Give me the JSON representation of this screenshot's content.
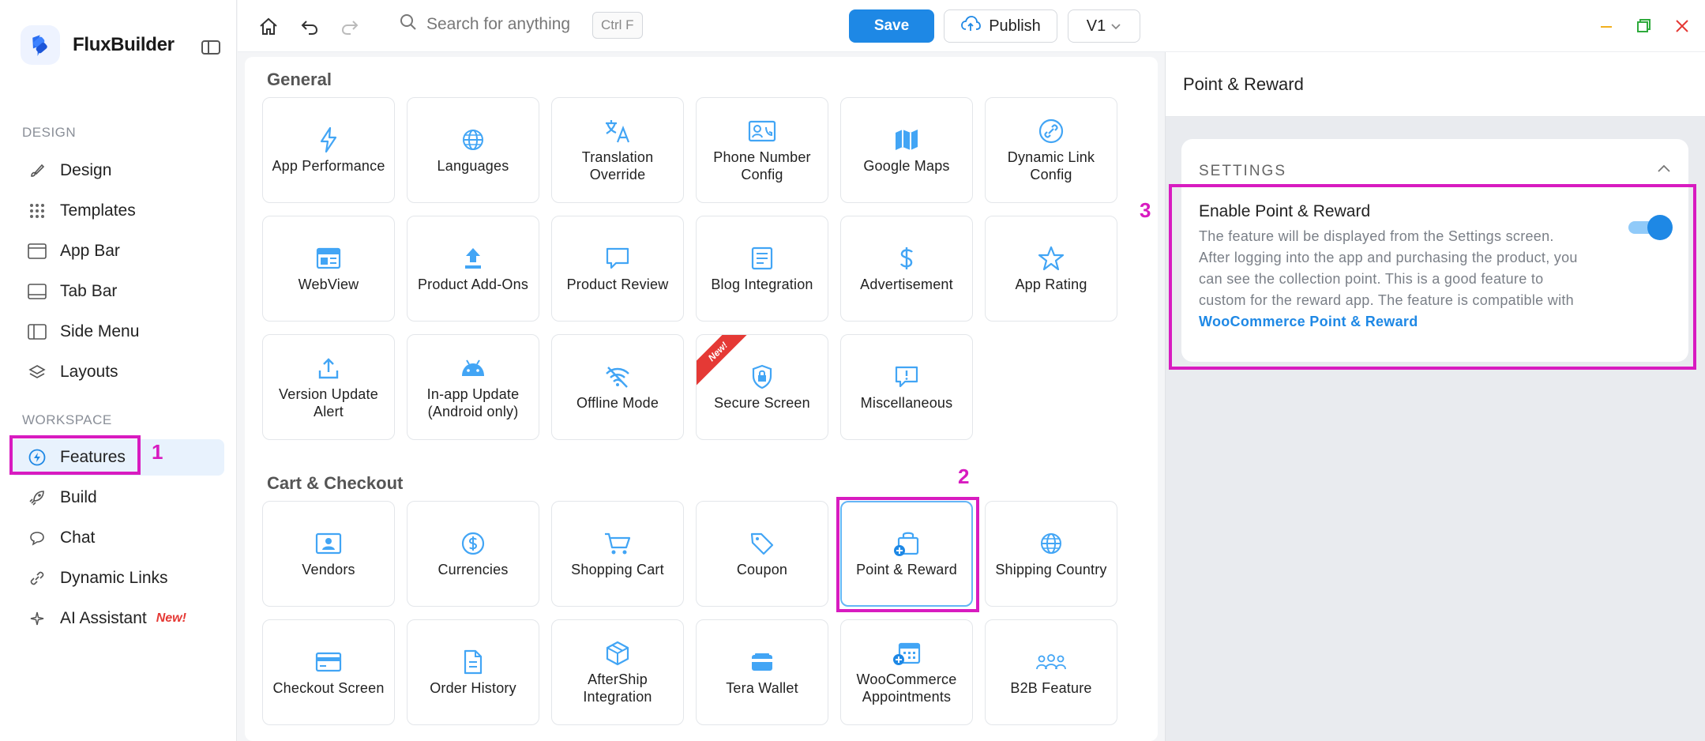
{
  "app": {
    "name": "FluxBuilder"
  },
  "sidebar": {
    "design_label": "DESIGN",
    "workspace_label": "WORKSPACE",
    "design_items": [
      {
        "label": "Design",
        "icon": "brush-icon"
      },
      {
        "label": "Templates",
        "icon": "grid-icon"
      },
      {
        "label": "App Bar",
        "icon": "app-bar-icon"
      },
      {
        "label": "Tab Bar",
        "icon": "tab-bar-icon"
      },
      {
        "label": "Side Menu",
        "icon": "side-menu-icon"
      },
      {
        "label": "Layouts",
        "icon": "layers-icon"
      }
    ],
    "workspace_items": [
      {
        "label": "Features",
        "icon": "lightning-icon",
        "active": true
      },
      {
        "label": "Build",
        "icon": "rocket-icon"
      },
      {
        "label": "Chat",
        "icon": "chat-icon"
      },
      {
        "label": "Dynamic Links",
        "icon": "link-icon"
      },
      {
        "label": "AI Assistant",
        "icon": "sparkle-icon",
        "badge": "New!"
      }
    ]
  },
  "topbar": {
    "search_placeholder": "Search for anything",
    "shortcut": "Ctrl F",
    "save_label": "Save",
    "publish_label": "Publish",
    "version_label": "V1"
  },
  "features": {
    "general_title": "General",
    "general": [
      {
        "label": "App Performance",
        "icon": "lightning-icon"
      },
      {
        "label": "Languages",
        "icon": "globe-icon"
      },
      {
        "label": "Translation Override",
        "icon": "translate-icon"
      },
      {
        "label": "Phone Number Config",
        "icon": "contact-card-icon"
      },
      {
        "label": "Google Maps",
        "icon": "map-icon"
      },
      {
        "label": "Dynamic Link Config",
        "icon": "link-icon"
      },
      {
        "label": "WebView",
        "icon": "browser-icon"
      },
      {
        "label": "Product Add-Ons",
        "icon": "upload-icon"
      },
      {
        "label": "Product Review",
        "icon": "comment-icon"
      },
      {
        "label": "Blog Integration",
        "icon": "article-icon"
      },
      {
        "label": "Advertisement",
        "icon": "dollar-icon"
      },
      {
        "label": "App Rating",
        "icon": "star-icon"
      },
      {
        "label": "Version Update Alert",
        "icon": "upload-tray-icon"
      },
      {
        "label": "In-app Update (Android only)",
        "icon": "android-icon"
      },
      {
        "label": "Offline Mode",
        "icon": "wifi-off-icon"
      },
      {
        "label": "Secure Screen",
        "icon": "shield-lock-icon",
        "ribbon": "New!"
      },
      {
        "label": "Miscellaneous",
        "icon": "alert-comment-icon"
      }
    ],
    "cart_title": "Cart & Checkout",
    "cart": [
      {
        "label": "Vendors",
        "icon": "vendor-card-icon"
      },
      {
        "label": "Currencies",
        "icon": "dollar-circle-icon"
      },
      {
        "label": "Shopping Cart",
        "icon": "cart-icon"
      },
      {
        "label": "Coupon",
        "icon": "tag-icon"
      },
      {
        "label": "Point & Reward",
        "icon": "bag-plus-icon",
        "selected": true
      },
      {
        "label": "Shipping Country",
        "icon": "globe-icon"
      },
      {
        "label": "Checkout Screen",
        "icon": "credit-card-icon"
      },
      {
        "label": "Order History",
        "icon": "document-icon"
      },
      {
        "label": "AfterShip Integration",
        "icon": "box-icon"
      },
      {
        "label": "Tera Wallet",
        "icon": "wallet-icon"
      },
      {
        "label": "WooCommerce Appointments",
        "icon": "calendar-plus-icon"
      },
      {
        "label": "B2B Feature",
        "icon": "group-icon"
      }
    ]
  },
  "callouts": [
    "1",
    "2",
    "3"
  ],
  "panel": {
    "title": "Point & Reward",
    "settings_label": "SETTINGS",
    "option_title": "Enable Point & Reward",
    "option_desc": "The feature will be displayed from the Settings screen. After logging into the app and purchasing the product, you can see the collection point. This is a good feature to custom for the reward app. The feature is compatible with ",
    "option_link": "WooCommerce Point & Reward",
    "toggle_on": true
  },
  "colors": {
    "accent": "#1e88e5",
    "highlight": "#d81bc0",
    "badge": "#e53935"
  }
}
